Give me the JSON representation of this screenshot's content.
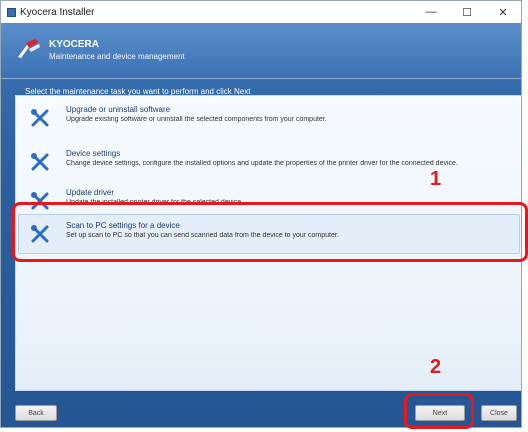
{
  "window": {
    "title": "Kyocera Installer",
    "minimize_glyph": "—",
    "maximize_glyph": "☐",
    "close_glyph": "✕"
  },
  "header": {
    "title": "KYOCERA",
    "subtitle": "Maintenance and device management"
  },
  "instruction": "Select the maintenance task you want to perform and click Next",
  "options": [
    {
      "icon": "tools-icon",
      "title": "Upgrade or uninstall software",
      "description": "Upgrade existing software or uninstall the selected components from your computer."
    },
    {
      "icon": "tools-icon",
      "title": "Device settings",
      "description": "Change device settings, configure the installed options and update the properties of the printer driver for the connected device."
    },
    {
      "icon": "tools-icon",
      "title": "Update driver",
      "description": "Update the installed printer driver for the selected device."
    },
    {
      "icon": "tools-icon",
      "title": "Scan to PC settings for a device",
      "description": "Set up scan to PC so that you can send scanned data from the device to your computer."
    }
  ],
  "callouts": {
    "one": "1",
    "two": "2"
  },
  "footer": {
    "back_label": "Back",
    "next_label": "Next",
    "cancel_label": "Close"
  },
  "colors": {
    "accent": "#2b5f9f",
    "highlight": "#e5191d",
    "icon": "#2b6cc4"
  }
}
